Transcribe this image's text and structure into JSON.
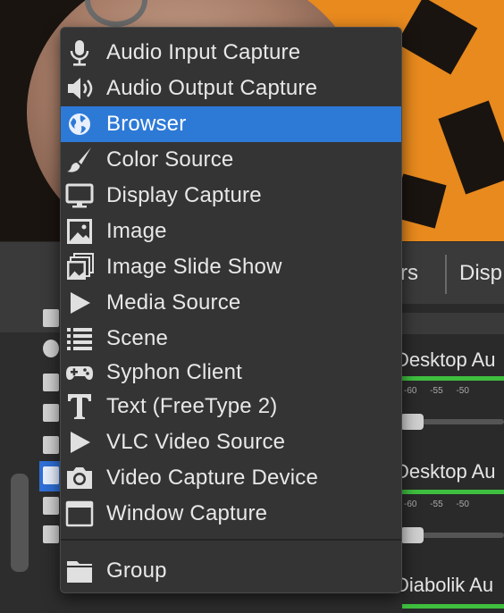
{
  "menu": {
    "items": [
      {
        "label": "Audio Input Capture",
        "icon": "microphone-icon"
      },
      {
        "label": "Audio Output Capture",
        "icon": "speaker-icon"
      },
      {
        "label": "Browser",
        "icon": "globe-icon",
        "highlighted": true
      },
      {
        "label": "Color Source",
        "icon": "paintbrush-icon"
      },
      {
        "label": "Display Capture",
        "icon": "monitor-icon"
      },
      {
        "label": "Image",
        "icon": "image-icon"
      },
      {
        "label": "Image Slide Show",
        "icon": "image-stack-icon"
      },
      {
        "label": "Media Source",
        "icon": "play-icon"
      },
      {
        "label": "Scene",
        "icon": "list-icon"
      },
      {
        "label": "Syphon Client",
        "icon": "gamepad-icon"
      },
      {
        "label": "Text (FreeType 2)",
        "icon": "text-icon"
      },
      {
        "label": "VLC Video Source",
        "icon": "play-icon"
      },
      {
        "label": "Video Capture Device",
        "icon": "camera-icon"
      },
      {
        "label": "Window Capture",
        "icon": "window-icon"
      }
    ],
    "group": {
      "label": "Group",
      "icon": "folder-icon"
    }
  },
  "colors": {
    "menu_bg": "#343434",
    "highlight": "#2d79d6",
    "text": "#e8e8e8",
    "meter": "#3fbf3f"
  },
  "background": {
    "dock_tab_partial_1": "rs",
    "dock_tab_partial_2": "Disp",
    "mixer_channels": [
      "Desktop Au",
      "Desktop Au",
      "Diabolik Au"
    ],
    "meter_ticks": "-60 -55 -50"
  }
}
